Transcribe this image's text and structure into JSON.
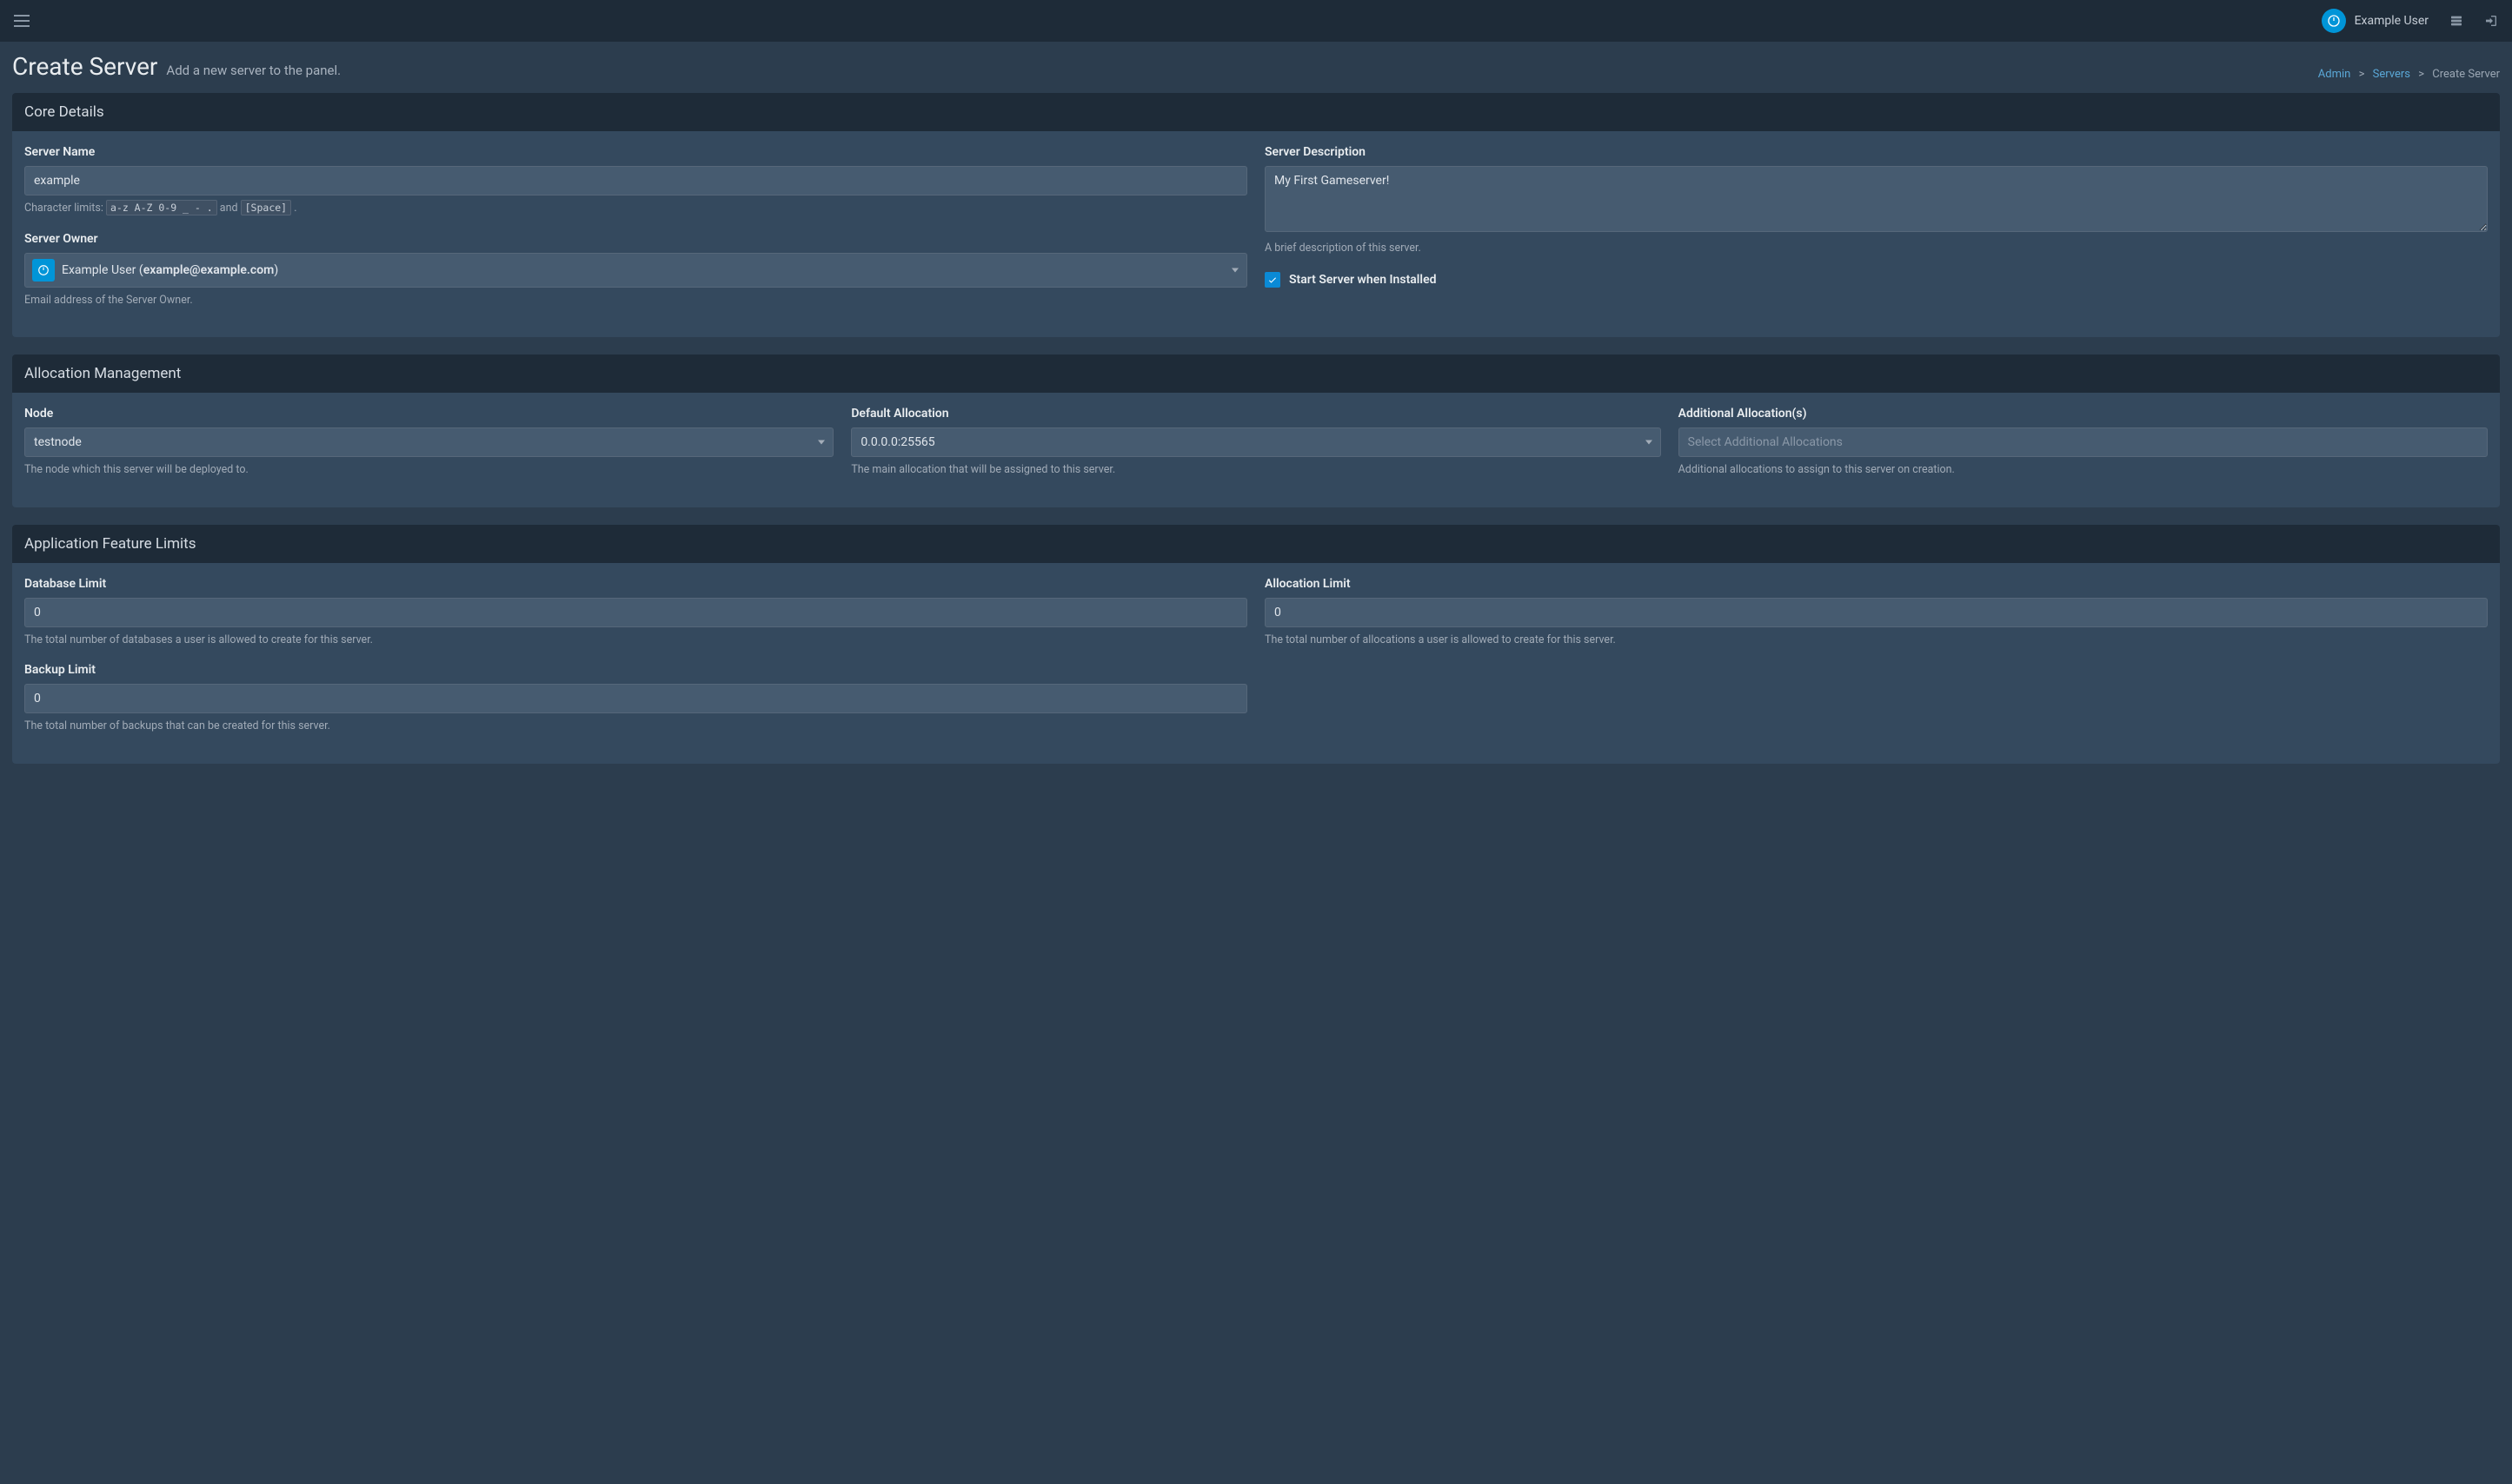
{
  "topbar": {
    "user_name": "Example User"
  },
  "page": {
    "title": "Create Server",
    "subtitle": "Add a new server to the panel."
  },
  "breadcrumbs": {
    "0": "Admin",
    "1": "Servers",
    "2": "Create Server"
  },
  "core": {
    "header": "Core Details",
    "server_name": {
      "label": "Server Name",
      "value": "example",
      "help_prefix": "Character limits: ",
      "help_code1": "a-z A-Z 0-9 _ - .",
      "help_and": " and ",
      "help_code2": "[Space]",
      "help_suffix": " ."
    },
    "server_owner": {
      "label": "Server Owner",
      "display_name": "Example User",
      "display_email": "example@example.com",
      "help": "Email address of the Server Owner."
    },
    "server_desc": {
      "label": "Server Description",
      "value": "My First Gameserver!",
      "help": "A brief description of this server."
    },
    "start_when_installed": {
      "label": "Start Server when Installed",
      "checked": true
    }
  },
  "alloc": {
    "header": "Allocation Management",
    "node": {
      "label": "Node",
      "value": "testnode",
      "help": "The node which this server will be deployed to."
    },
    "default_alloc": {
      "label": "Default Allocation",
      "value": "0.0.0.0:25565",
      "help": "The main allocation that will be assigned to this server."
    },
    "additional": {
      "label": "Additional Allocation(s)",
      "placeholder": "Select Additional Allocations",
      "help": "Additional allocations to assign to this server on creation."
    }
  },
  "limits": {
    "header": "Application Feature Limits",
    "database": {
      "label": "Database Limit",
      "value": "0",
      "help": "The total number of databases a user is allowed to create for this server."
    },
    "allocation": {
      "label": "Allocation Limit",
      "value": "0",
      "help": "The total number of allocations a user is allowed to create for this server."
    },
    "backup": {
      "label": "Backup Limit",
      "value": "0",
      "help": "The total number of backups that can be created for this server."
    }
  }
}
